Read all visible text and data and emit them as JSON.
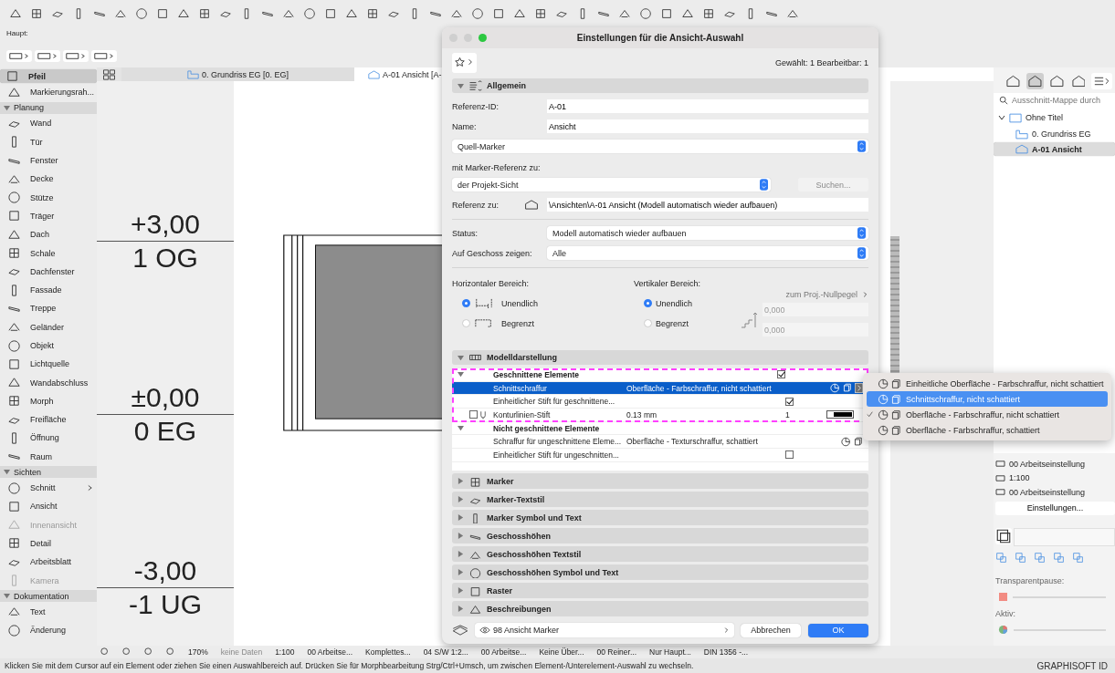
{
  "toolbar": {
    "label": "Haupt:"
  },
  "tabs": [
    {
      "label": "0. Grundriss EG [0. EG]",
      "selected": false
    },
    {
      "label": "A-01 Ansicht [A-",
      "selected": true
    }
  ],
  "toolbox": [
    {
      "kind": "tool",
      "label": "Pfeil",
      "selected": true,
      "disabled": false
    },
    {
      "kind": "tool",
      "label": "Markierungsrah...",
      "selected": false,
      "disabled": false
    },
    {
      "kind": "section",
      "label": "Planung",
      "expanded": true
    },
    {
      "kind": "tool",
      "label": "Wand",
      "selected": false,
      "disabled": false
    },
    {
      "kind": "tool",
      "label": "Tür",
      "selected": false,
      "disabled": false
    },
    {
      "kind": "tool",
      "label": "Fenster",
      "selected": false,
      "disabled": false
    },
    {
      "kind": "tool",
      "label": "Decke",
      "selected": false,
      "disabled": false
    },
    {
      "kind": "tool",
      "label": "Stütze",
      "selected": false,
      "disabled": false
    },
    {
      "kind": "tool",
      "label": "Träger",
      "selected": false,
      "disabled": false
    },
    {
      "kind": "tool",
      "label": "Dach",
      "selected": false,
      "disabled": false
    },
    {
      "kind": "tool",
      "label": "Schale",
      "selected": false,
      "disabled": false
    },
    {
      "kind": "tool",
      "label": "Dachfenster",
      "selected": false,
      "disabled": false
    },
    {
      "kind": "tool",
      "label": "Fassade",
      "selected": false,
      "disabled": false
    },
    {
      "kind": "tool",
      "label": "Treppe",
      "selected": false,
      "disabled": false
    },
    {
      "kind": "tool",
      "label": "Geländer",
      "selected": false,
      "disabled": false
    },
    {
      "kind": "tool",
      "label": "Objekt",
      "selected": false,
      "disabled": false
    },
    {
      "kind": "tool",
      "label": "Lichtquelle",
      "selected": false,
      "disabled": false
    },
    {
      "kind": "tool",
      "label": "Wandabschluss",
      "selected": false,
      "disabled": false
    },
    {
      "kind": "tool",
      "label": "Morph",
      "selected": false,
      "disabled": false
    },
    {
      "kind": "tool",
      "label": "Freifläche",
      "selected": false,
      "disabled": false
    },
    {
      "kind": "tool",
      "label": "Öffnung",
      "selected": false,
      "disabled": false
    },
    {
      "kind": "tool",
      "label": "Raum",
      "selected": false,
      "disabled": false
    },
    {
      "kind": "section",
      "label": "Sichten",
      "expanded": true
    },
    {
      "kind": "tool",
      "label": "Schnitt",
      "selected": false,
      "disabled": false,
      "submenu": true
    },
    {
      "kind": "tool",
      "label": "Ansicht",
      "selected": false,
      "disabled": false
    },
    {
      "kind": "tool",
      "label": "Innenansicht",
      "selected": false,
      "disabled": true
    },
    {
      "kind": "tool",
      "label": "Detail",
      "selected": false,
      "disabled": false
    },
    {
      "kind": "tool",
      "label": "Arbeitsblatt",
      "selected": false,
      "disabled": false
    },
    {
      "kind": "tool",
      "label": "Kamera",
      "selected": false,
      "disabled": true
    },
    {
      "kind": "section",
      "label": "Dokumentation",
      "expanded": true
    },
    {
      "kind": "tool",
      "label": "Text",
      "selected": false,
      "disabled": false
    },
    {
      "kind": "tool",
      "label": "Änderung",
      "selected": false,
      "disabled": false
    }
  ],
  "drawing": {
    "levels": [
      {
        "elevation": "+3,00",
        "name": "1 OG"
      },
      {
        "elevation": "±0,00",
        "name": "0 EG"
      },
      {
        "elevation": "-3,00",
        "name": "-1 UG"
      }
    ]
  },
  "dialog": {
    "title": "Einstellungen für die Ansicht-Auswahl",
    "selection_info": "Gewählt: 1 Bearbeitbar: 1",
    "general": {
      "label": "Allgemein",
      "expanded": true,
      "ref_id": {
        "label": "Referenz-ID:",
        "value": "A-01"
      },
      "name": {
        "label": "Name:",
        "value": "Ansicht"
      },
      "marker_type": "Quell-Marker",
      "ref_label": "mit Marker-Referenz zu:",
      "ref_target": "der Projekt-Sicht",
      "search_button": {
        "label": "Suchen...",
        "disabled": true
      },
      "reference": {
        "label": "Referenz zu:",
        "value": "\\Ansichten\\A-01 Ansicht (Modell automatisch wieder aufbauen)"
      },
      "status": {
        "label": "Status:",
        "value": "Modell automatisch wieder aufbauen"
      },
      "show_on": {
        "label": "Auf Geschoss zeigen:",
        "value": "Alle"
      },
      "horizontal": {
        "label": "Horizontaler Bereich:",
        "options": [
          {
            "label": "Unendlich",
            "selected": true
          },
          {
            "label": "Begrenzt",
            "selected": false
          }
        ]
      },
      "vertical": {
        "label": "Vertikaler Bereich:",
        "options": [
          {
            "label": "Unendlich",
            "selected": true
          },
          {
            "label": "Begrenzt",
            "selected": false
          }
        ]
      },
      "zero_level": "zum Proj.-Nullpegel",
      "limits": [
        "0,000",
        "0,000"
      ]
    },
    "model": {
      "label": "Modelldarstellung",
      "expanded": true,
      "groups": [
        {
          "label": "Geschnittene Elemente",
          "expanded": true,
          "checked": true,
          "highlighted": true,
          "rows": [
            {
              "kind": "fill",
              "label": "Schnittschraffur",
              "value": "Oberfläche - Farbschraffur, nicht schattiert",
              "selected": true
            },
            {
              "kind": "check",
              "label": "Einheitlicher Stift für geschnittene...",
              "checked": true,
              "selected": false
            },
            {
              "kind": "pen",
              "label": "Konturlinien-Stift",
              "value": "0.13 mm",
              "pen": "1",
              "checked": false,
              "selected": false
            }
          ]
        },
        {
          "label": "Nicht geschnittene Elemente",
          "expanded": true,
          "highlighted": false,
          "rows": [
            {
              "kind": "fill",
              "label": "Schraffur für ungeschnittene Eleme...",
              "value": "Oberfläche - Texturschraffur, schattiert",
              "selected": false
            },
            {
              "kind": "check",
              "label": "Einheitlicher Stift für ungeschnitten...",
              "checked": false,
              "selected": false
            }
          ]
        }
      ]
    },
    "sections": [
      {
        "label": "Marker",
        "expanded": false
      },
      {
        "label": "Marker-Textstil",
        "expanded": false
      },
      {
        "label": "Marker Symbol und Text",
        "expanded": false
      },
      {
        "label": "Geschosshöhen",
        "expanded": false
      },
      {
        "label": "Geschosshöhen Textstil",
        "expanded": false
      },
      {
        "label": "Geschosshöhen Symbol und Text",
        "expanded": false
      },
      {
        "label": "Raster",
        "expanded": false
      },
      {
        "label": "Beschreibungen",
        "expanded": false
      }
    ],
    "layer": "98 Ansicht Marker",
    "buttons": [
      {
        "label": "Abbrechen",
        "kind": "cancel"
      },
      {
        "label": "OK",
        "kind": "default"
      }
    ]
  },
  "popup_menu": [
    {
      "label": "Einheitliche Oberfläche - Farbschraffur, nicht schattiert",
      "selected": false,
      "checked": false
    },
    {
      "label": "Schnittschraffur, nicht schattiert",
      "selected": true,
      "checked": false
    },
    {
      "label": "Oberfläche - Farbschraffur, nicht schattiert",
      "selected": false,
      "checked": true
    },
    {
      "label": "Oberfläche - Farbschraffur, schattiert",
      "selected": false,
      "checked": false
    }
  ],
  "navigator": {
    "view_buttons": [
      {
        "selected": false
      },
      {
        "selected": true
      },
      {
        "selected": false
      },
      {
        "selected": false
      }
    ],
    "search": {
      "placeholder": "Ausschnitt-Mappe durch"
    },
    "tree": {
      "label": "Ohne Titel",
      "expanded": true,
      "children": [
        {
          "label": "0. Grundriss EG",
          "selected": false
        },
        {
          "label": "A-01 Ansicht",
          "selected": true
        }
      ]
    },
    "info": [
      "00 Arbeitseinstellung",
      "1:100",
      "00 Arbeitseinstellung"
    ],
    "settings_button": "Einstellungen...",
    "trace_label": "Transparentpause:",
    "active_label": "Aktiv:"
  },
  "bottom_bar": [
    {
      "label": "170%",
      "disabled": false
    },
    {
      "label": "keine Daten",
      "disabled": true
    },
    {
      "label": "1:100",
      "disabled": false
    },
    {
      "label": "00 Arbeitse...",
      "disabled": false
    },
    {
      "label": "Komplettes...",
      "disabled": false
    },
    {
      "label": "04 S/W 1:2...",
      "disabled": false
    },
    {
      "label": "00 Arbeitse...",
      "disabled": false
    },
    {
      "label": "Keine Über...",
      "disabled": false
    },
    {
      "label": "00 Reiner...",
      "disabled": false
    },
    {
      "label": "Nur Haupt...",
      "disabled": false
    },
    {
      "label": "DIN 1356 -...",
      "disabled": false
    }
  ],
  "status_text": "Klicken Sie mit dem Cursor auf ein Element oder ziehen Sie einen Auswahlbereich auf. Drücken Sie für Morphbearbeitung Strg/Ctrl+Umsch, um zwischen Element-/Unterelement-Auswahl zu wechseln.",
  "brand": "GRAPHISOFT ID"
}
